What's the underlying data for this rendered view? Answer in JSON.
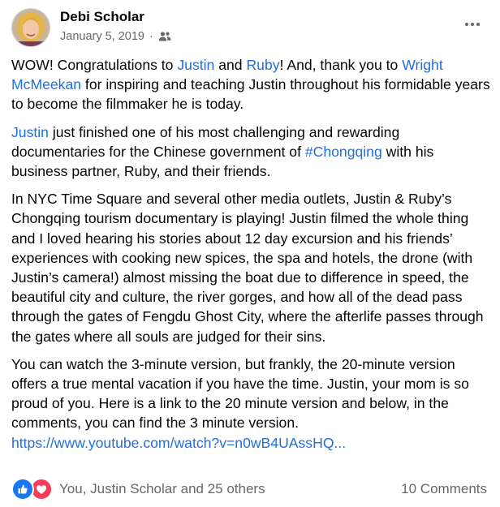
{
  "post": {
    "author": "Debi Scholar",
    "date": "January 5, 2019",
    "separator": "·",
    "audience_icon": "friends-icon",
    "more_icon": "more-horizontal-icon"
  },
  "content": {
    "p1": {
      "t1": "WOW!  Congratulations to ",
      "link1": "Justin",
      "t2": " and ",
      "link2": "Ruby",
      "t3": "! And, thank you to ",
      "link3": "Wright McMeekan",
      "t4": " for inspiring and teaching Justin throughout his formidable years to become the filmmaker he is today."
    },
    "p2": {
      "link1": "Justin",
      "t1": " just finished one of his most challenging and rewarding documentaries for the Chinese government of ",
      "hashtag": "#Chongqing",
      "t2": "  with his business partner, Ruby, and their friends."
    },
    "p3": "In NYC Time Square and several other media outlets, Justin & Ruby’s Chongqing tourism documentary is playing!  Justin filmed the whole thing and I loved hearing his stories about 12 day excursion and his friends’ experiences with cooking new spices, the spa and hotels, the drone (with Justin’s camera!) almost missing the boat due to difference in speed, the beautiful city and culture,  the river gorges, and how all of the dead pass through the gates of Fengdu Ghost City, where the afterlife passes through the gates where all souls are judged for their sins.",
    "p4": {
      "t1": "You can watch the 3-minute version, but frankly, the 20-minute version offers a true mental vacation if you have the time.  Justin, your mom is so proud of you.  Here is a link to the 20 minute version and below, in the comments, you can find the 3 minute version.",
      "url": "https://www.youtube.com/watch?v=n0wB4UAssHQ..."
    }
  },
  "footer": {
    "reactions_text": "You, Justin Scholar and 25 others",
    "comments_text": "10 Comments",
    "reaction_icons": [
      "like-icon",
      "love-icon"
    ]
  },
  "colors": {
    "link": "#216fdb",
    "secondary_text": "#65676b",
    "like": "#1877f2",
    "love": "#f33e58"
  }
}
